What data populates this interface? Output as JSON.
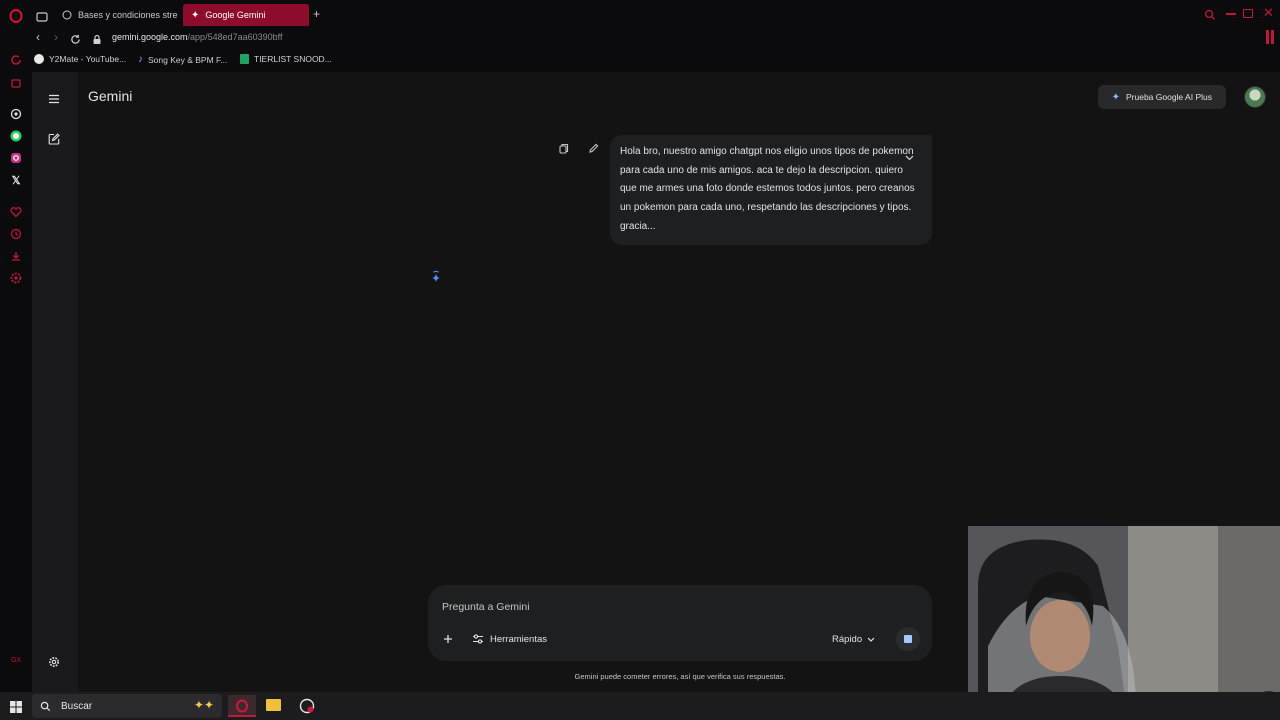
{
  "browser": {
    "tabs": [
      {
        "title": "Bases y condiciones stre",
        "active": false
      },
      {
        "title": "Google Gemini",
        "active": true
      }
    ],
    "url_host": "gemini.google.com",
    "url_path": "/app/548ed7aa60390bff",
    "bookmarks": [
      "Y2Mate - YouTube...",
      "Song Key & BPM F...",
      "TIERLIST SNOOD..."
    ],
    "accent_color": "#8d0b2b"
  },
  "app": {
    "title": "Gemini",
    "promo_label": "Prueba Google AI Plus",
    "user_message": "Hola bro, nuestro amigo chatgpt nos eligio unos tipos de pokemon para cada uno de mis amigos. aca te dejo la descripcion. quiero que me armes una foto donde estemos todos juntos. pero creanos un pokemon para cada uno, respetando las descripciones y tipos. gracia...",
    "composer": {
      "placeholder": "Pregunta a Gemini",
      "tools_label": "Herramientas",
      "model_label": "Rápido"
    },
    "disclaimer": "Gemini puede cometer errores, así que verifica sus respuestas."
  },
  "taskbar": {
    "search_label": "Buscar"
  },
  "icons": [
    "opera-logo-icon",
    "menu-icon",
    "new-chat-icon",
    "settings-icon",
    "sparkle-icon",
    "copy-icon",
    "edit-icon",
    "chevron-down-icon",
    "plus-icon",
    "tools-icon",
    "stop-icon",
    "windows-start-icon",
    "search-icon",
    "lock-icon",
    "back-icon",
    "forward-icon",
    "reload-icon"
  ]
}
